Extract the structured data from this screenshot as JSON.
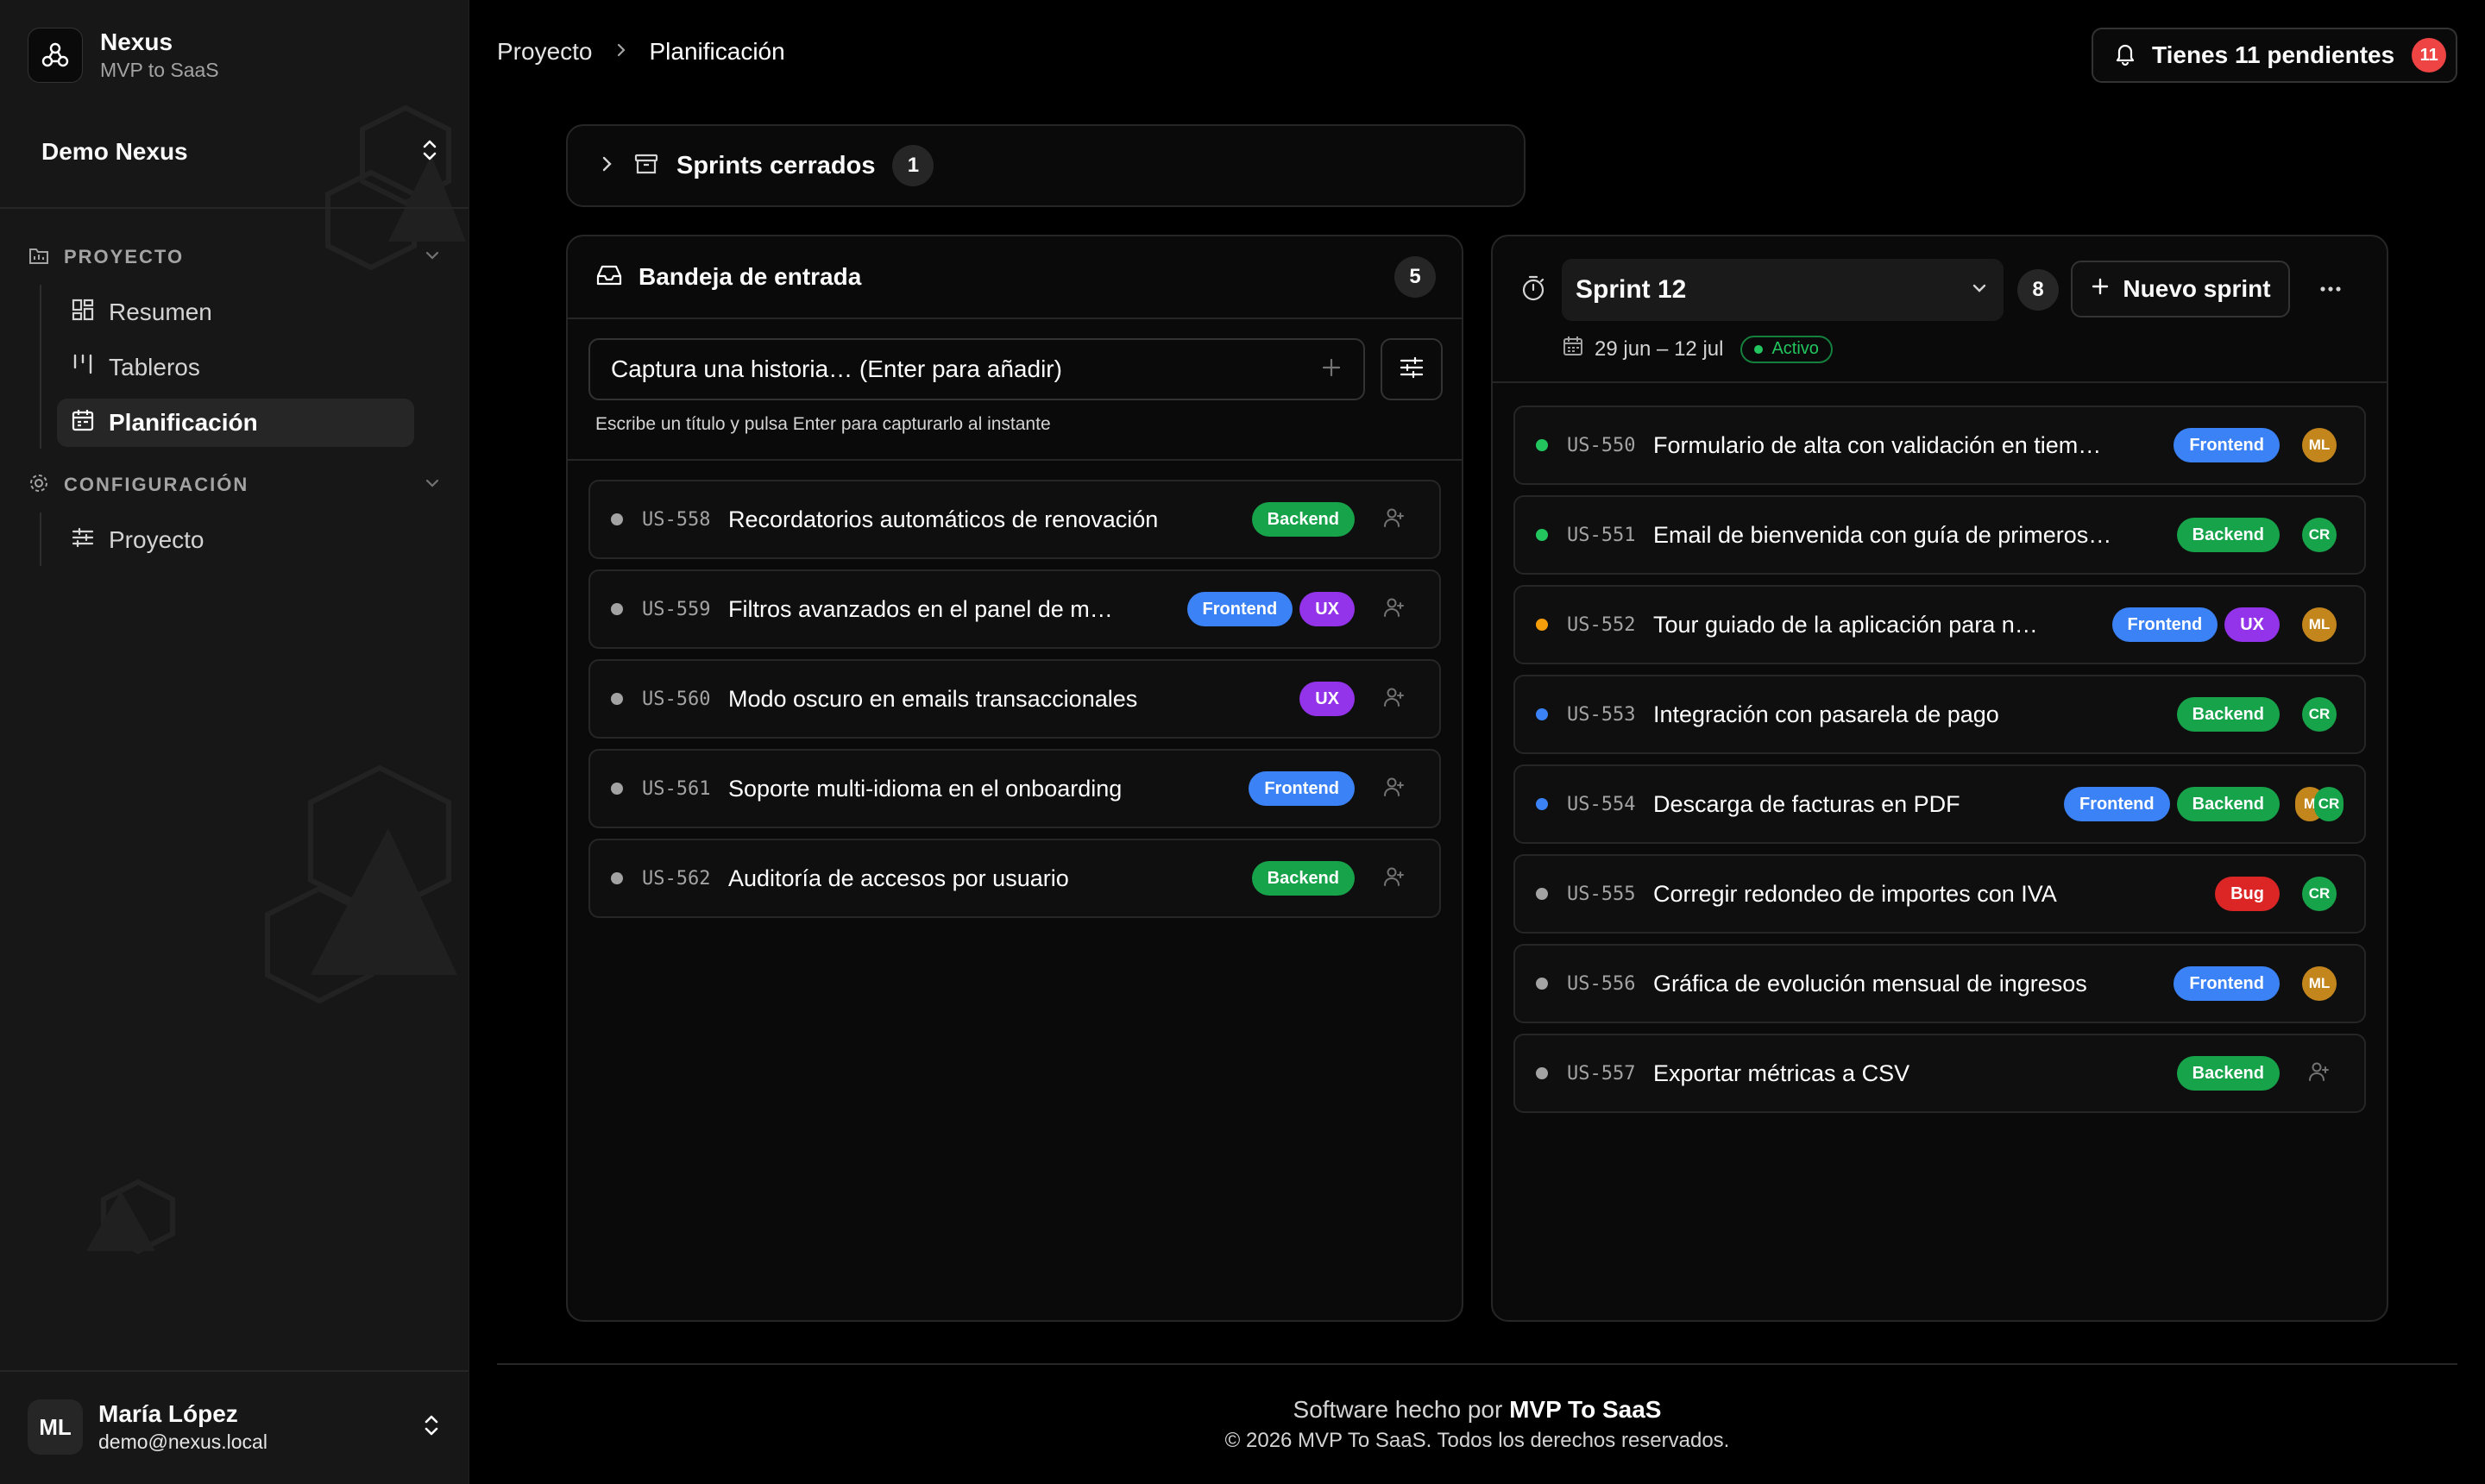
{
  "app": {
    "name": "Nexus",
    "subtitle": "MVP to SaaS",
    "workspace": "Demo Nexus"
  },
  "sidebar": {
    "groups": [
      {
        "label": "PROYECTO",
        "items": [
          {
            "label": "Resumen",
            "icon": "grid-icon"
          },
          {
            "label": "Tableros",
            "icon": "columns-icon"
          },
          {
            "label": "Planificación",
            "icon": "calendar-icon",
            "active": true
          }
        ]
      },
      {
        "label": "CONFIGURACIÓN",
        "items": [
          {
            "label": "Proyecto",
            "icon": "sliders-icon"
          }
        ]
      }
    ],
    "user": {
      "initials": "ML",
      "name": "María López",
      "email": "demo@nexus.local"
    }
  },
  "header": {
    "breadcrumb": [
      "Proyecto",
      "Planificación"
    ],
    "notifications": {
      "label": "Tienes 11 pendientes",
      "count": "11"
    }
  },
  "closed_sprints": {
    "label": "Sprints cerrados",
    "count": "1"
  },
  "inbox": {
    "title": "Bandeja de entrada",
    "count": "5",
    "capture_placeholder": "Captura una historia… (Enter para añadir)",
    "hint": "Escribe un título y pulsa Enter para capturarlo al instante",
    "stories": [
      {
        "id": "US-558",
        "title": "Recordatorios automáticos de renovación",
        "tags": [
          "Backend"
        ]
      },
      {
        "id": "US-559",
        "title": "Filtros avanzados en el panel de m…",
        "tags": [
          "Frontend",
          "UX"
        ]
      },
      {
        "id": "US-560",
        "title": "Modo oscuro en emails transaccionales",
        "tags": [
          "UX"
        ]
      },
      {
        "id": "US-561",
        "title": "Soporte multi-idioma en el onboarding",
        "tags": [
          "Frontend"
        ]
      },
      {
        "id": "US-562",
        "title": "Auditoría de accesos por usuario",
        "tags": [
          "Backend"
        ]
      }
    ]
  },
  "sprint": {
    "name": "Sprint 12",
    "count": "8",
    "new_sprint_label": "Nuevo sprint",
    "dates": "29 jun – 12 jul",
    "status": "Activo",
    "stories": [
      {
        "id": "US-550",
        "title": "Formulario de alta con validación en tiem…",
        "tags": [
          "Frontend"
        ],
        "assignees": [
          "ML"
        ],
        "status_color": "#22c55e"
      },
      {
        "id": "US-551",
        "title": "Email de bienvenida con guía de primeros…",
        "tags": [
          "Backend"
        ],
        "assignees": [
          "CR"
        ],
        "status_color": "#22c55e"
      },
      {
        "id": "US-552",
        "title": "Tour guiado de la aplicación para n…",
        "tags": [
          "Frontend",
          "UX"
        ],
        "assignees": [
          "ML"
        ],
        "status_color": "#f59e0b"
      },
      {
        "id": "US-553",
        "title": "Integración con pasarela de pago",
        "tags": [
          "Backend"
        ],
        "assignees": [
          "CR"
        ],
        "status_color": "#3b82f6"
      },
      {
        "id": "US-554",
        "title": "Descarga de facturas en PDF",
        "tags": [
          "Frontend",
          "Backend"
        ],
        "assignees": [
          "M",
          "CR"
        ],
        "status_color": "#3b82f6"
      },
      {
        "id": "US-555",
        "title": "Corregir redondeo de importes con IVA",
        "tags": [
          "Bug"
        ],
        "assignees": [
          "CR"
        ],
        "status_color": "#a3a3a3"
      },
      {
        "id": "US-556",
        "title": "Gráfica de evolución mensual de ingresos",
        "tags": [
          "Frontend"
        ],
        "assignees": [
          "ML"
        ],
        "status_color": "#a3a3a3"
      },
      {
        "id": "US-557",
        "title": "Exportar métricas a CSV",
        "tags": [
          "Backend"
        ],
        "assignees": [],
        "status_color": "#a3a3a3"
      }
    ]
  },
  "footer": {
    "made_by_prefix": "Software hecho por",
    "made_by_brand": "MVP To SaaS",
    "copyright": "© 2026 MVP To SaaS. Todos los derechos reservados."
  },
  "colors": {
    "backend": "#16a34a",
    "frontend": "#3b82f6",
    "ux": "#9333ea",
    "bug": "#dc2626",
    "active": "#22c55e",
    "badge": "#ef4444"
  }
}
